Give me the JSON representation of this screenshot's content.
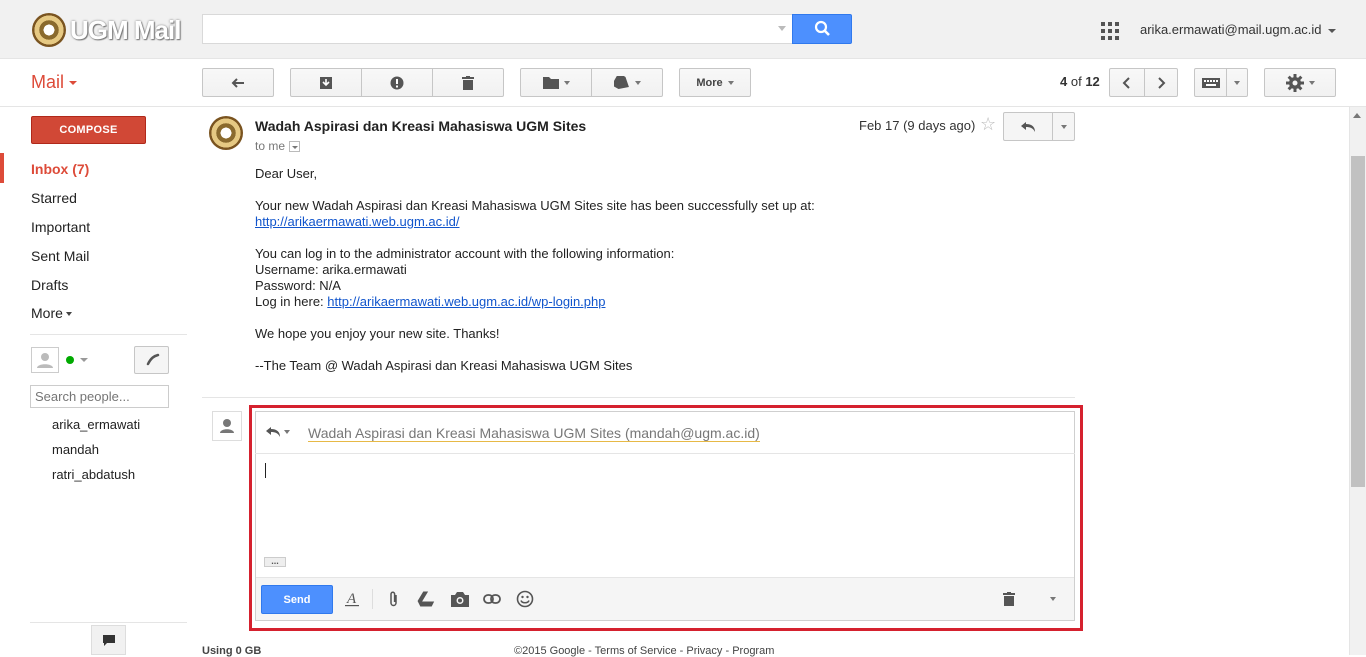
{
  "header": {
    "logo_text": "UGM Mail",
    "search": {
      "value": "",
      "placeholder": ""
    },
    "account": "arika.ermawati@mail.ugm.ac.id"
  },
  "toolbar": {
    "mail_label": "Mail",
    "more_label": "More",
    "pager": {
      "current": "4",
      "of_word": "of",
      "total": "12"
    }
  },
  "sidebar": {
    "compose_label": "COMPOSE",
    "items": [
      {
        "label": "Inbox (7)",
        "active": true
      },
      {
        "label": "Starred"
      },
      {
        "label": "Important"
      },
      {
        "label": "Sent Mail"
      },
      {
        "label": "Drafts"
      },
      {
        "label": "More"
      }
    ],
    "people_search_placeholder": "Search people...",
    "contacts": [
      "arika_ermawati",
      "mandah",
      "ratri_abdatush"
    ]
  },
  "message": {
    "sender": "Wadah Aspirasi dan Kreasi Mahasiswa UGM Sites",
    "to": "to me",
    "date": "Feb 17 (9 days ago)",
    "greeting": "Dear User,",
    "intro": "Your new Wadah Aspirasi dan Kreasi Mahasiswa UGM Sites site has been successfully set up at:",
    "site_link": "http://arikaermawati.web.ugm.ac.id/",
    "login_intro": "You can log in to the administrator account with the following information:",
    "username_line": "Username: arika.ermawati",
    "password_line": "Password: N/A",
    "login_prefix": "Log in here: ",
    "login_link": "http://arikaermawati.web.ugm.ac.id/wp-login.php",
    "closing": "We hope you enjoy your new site. Thanks!",
    "signature": "--The Team @ Wadah Aspirasi dan Kreasi Mahasiswa UGM Sites"
  },
  "reply": {
    "recipient": "Wadah Aspirasi dan Kreasi Mahasiswa UGM Sites (mandah@ugm.ac.id)",
    "body": "",
    "trim_label": "...",
    "send_label": "Send"
  },
  "footer": {
    "storage": "Using 0 GB",
    "links": "©2015 Google - Terms of Service - Privacy - Program"
  },
  "colors": {
    "brand_red": "#dd4b39",
    "compose_red": "#d14836",
    "action_blue": "#4d90fe",
    "link_blue": "#15c",
    "highlight_red": "#d5212e"
  }
}
